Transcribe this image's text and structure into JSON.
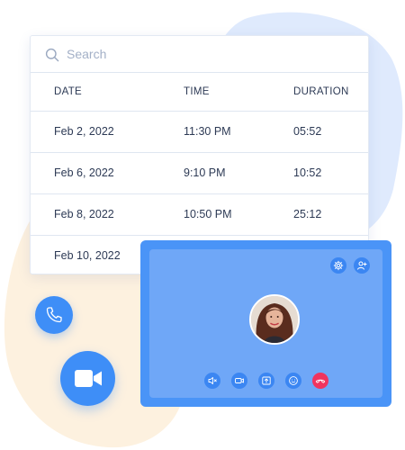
{
  "search": {
    "placeholder": "Search"
  },
  "table": {
    "headers": [
      "DATE",
      "TIME",
      "DURATION"
    ],
    "rows": [
      [
        "Feb 2, 2022",
        "11:30 PM",
        "05:52"
      ],
      [
        "Feb 6, 2022",
        "9:10 PM",
        "10:52"
      ],
      [
        "Feb 8, 2022",
        "10:50 PM",
        "25:12"
      ],
      [
        "Feb 10, 2022",
        "",
        ""
      ]
    ]
  },
  "icons": {
    "search": "search-icon",
    "settings": "gear-icon",
    "add_user": "add-user-icon",
    "volume": "volume-icon",
    "camera": "video-camera-icon",
    "share": "share-screen-icon",
    "emoji": "emoji-icon",
    "end_call": "end-call-icon",
    "phone": "phone-icon",
    "video": "video-icon"
  },
  "colors": {
    "primary": "#3e8ef7",
    "panel": "#4a94f7",
    "panel_inner": "#6fa7f7",
    "end_call": "#f0345f",
    "blob_blue": "#dfeafd",
    "blob_peach": "#fdf1df"
  }
}
